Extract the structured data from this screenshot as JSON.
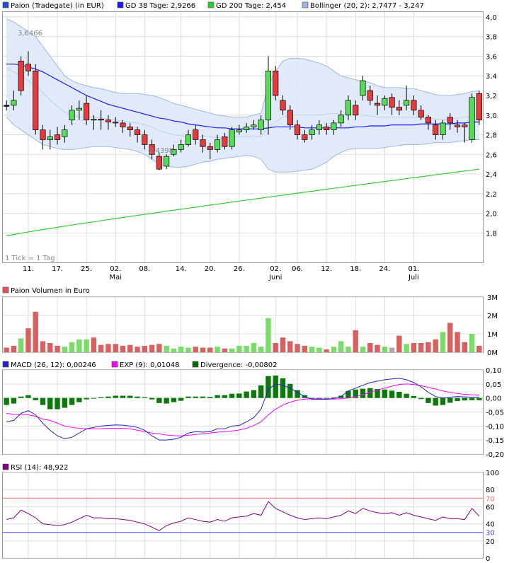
{
  "chart_data": [
    {
      "type": "candlestick",
      "legend": [
        {
          "label": "Paion (Tradegate) (in EUR)",
          "color": "#1f4fd8"
        },
        {
          "label": "GD 38 Tage: 2,9266",
          "color": "#1a1aff"
        },
        {
          "label": "GD 200 Tage: 2,454",
          "color": "#33cc33"
        },
        {
          "label": "Bollinger (20, 2): 2,7477 - 3,247",
          "color": "#9fb8e0"
        }
      ],
      "ylim": [
        1.5,
        4.05
      ],
      "yticks": [
        "1,8",
        "2,0",
        "2,2",
        "2,4",
        "2,6",
        "2,8",
        "3,0",
        "3,2",
        "3,4",
        "3,6",
        "3,8",
        "4,0"
      ],
      "xticks": [
        "11.",
        "17.",
        "25.",
        "02.",
        "08.",
        "14.",
        "20.",
        "26.",
        "02.",
        "06.",
        "12.",
        "18.",
        "24.",
        "01."
      ],
      "month_labels": [
        "Mai",
        "Juni",
        "Juli"
      ],
      "annotations": [
        "3,6466",
        "2,4398"
      ],
      "footnote": "1 Tick = 1 Tag",
      "candles": [
        [
          3.1,
          3.1,
          3.15,
          3.05
        ],
        [
          3.1,
          3.15,
          3.25,
          3.05
        ],
        [
          3.55,
          3.25,
          3.6,
          3.2
        ],
        [
          3.52,
          3.45,
          3.65,
          3.4
        ],
        [
          3.45,
          2.85,
          3.52,
          2.8
        ],
        [
          2.85,
          2.75,
          2.9,
          2.65
        ],
        [
          2.75,
          2.78,
          2.85,
          2.65
        ],
        [
          2.8,
          2.75,
          2.88,
          2.7
        ],
        [
          2.78,
          2.85,
          2.9,
          2.72
        ],
        [
          2.95,
          3.05,
          3.1,
          2.9
        ],
        [
          3.05,
          3.07,
          3.15,
          2.95
        ],
        [
          3.12,
          2.95,
          3.2,
          2.9
        ],
        [
          2.95,
          2.96,
          3.0,
          2.85
        ],
        [
          2.96,
          2.95,
          3.05,
          2.85
        ],
        [
          2.95,
          2.93,
          3.0,
          2.85
        ],
        [
          2.93,
          2.92,
          2.98,
          2.88
        ],
        [
          2.92,
          2.88,
          2.95,
          2.82
        ],
        [
          2.88,
          2.85,
          2.92,
          2.78
        ],
        [
          2.85,
          2.8,
          2.88,
          2.72
        ],
        [
          2.8,
          2.7,
          2.85,
          2.65
        ],
        [
          2.7,
          2.6,
          2.75,
          2.55
        ],
        [
          2.58,
          2.45,
          2.62,
          2.44
        ],
        [
          2.48,
          2.58,
          2.6,
          2.45
        ],
        [
          2.6,
          2.65,
          2.7,
          2.58
        ],
        [
          2.65,
          2.7,
          2.75,
          2.62
        ],
        [
          2.7,
          2.8,
          2.85,
          2.68
        ],
        [
          2.85,
          2.75,
          2.9,
          2.7
        ],
        [
          2.75,
          2.68,
          2.8,
          2.62
        ],
        [
          2.68,
          2.65,
          2.72,
          2.55
        ],
        [
          2.65,
          2.75,
          2.8,
          2.62
        ],
        [
          2.78,
          2.68,
          2.82,
          2.65
        ],
        [
          2.68,
          2.85,
          2.88,
          2.65
        ],
        [
          2.83,
          2.85,
          2.9,
          2.8
        ],
        [
          2.85,
          2.88,
          2.92,
          2.82
        ],
        [
          2.88,
          2.9,
          2.95,
          2.85
        ],
        [
          2.85,
          2.95,
          3.0,
          2.8
        ],
        [
          2.95,
          3.45,
          3.6,
          2.8
        ],
        [
          3.45,
          3.2,
          3.5,
          3.15
        ],
        [
          3.15,
          3.05,
          3.2,
          3.0
        ],
        [
          3.05,
          2.9,
          3.1,
          2.85
        ],
        [
          2.9,
          2.8,
          2.95,
          2.75
        ],
        [
          2.8,
          2.75,
          2.85,
          2.72
        ],
        [
          2.8,
          2.85,
          2.9,
          2.75
        ],
        [
          2.85,
          2.9,
          2.95,
          2.8
        ],
        [
          2.88,
          2.85,
          2.92,
          2.8
        ],
        [
          2.85,
          2.92,
          2.95,
          2.8
        ],
        [
          2.92,
          3.0,
          3.05,
          2.88
        ],
        [
          3.0,
          3.15,
          3.2,
          2.95
        ],
        [
          3.1,
          3.0,
          3.15,
          2.95
        ],
        [
          3.2,
          3.35,
          3.4,
          3.15
        ],
        [
          3.25,
          3.15,
          3.3,
          3.1
        ],
        [
          3.12,
          3.1,
          3.2,
          3.0
        ],
        [
          3.1,
          3.17,
          3.2,
          3.05
        ],
        [
          3.18,
          3.08,
          3.22,
          3.0
        ],
        [
          3.08,
          3.05,
          3.15,
          3.0
        ],
        [
          3.1,
          3.15,
          3.3,
          3.05
        ],
        [
          3.15,
          3.05,
          3.2,
          3.0
        ],
        [
          3.05,
          2.98,
          3.1,
          2.95
        ],
        [
          2.98,
          2.92,
          3.0,
          2.85
        ],
        [
          2.9,
          2.8,
          2.95,
          2.75
        ],
        [
          2.8,
          2.92,
          2.95,
          2.75
        ],
        [
          2.98,
          2.92,
          3.02,
          2.85
        ],
        [
          2.9,
          2.88,
          2.95,
          2.82
        ],
        [
          2.9,
          2.88,
          2.92,
          2.72
        ],
        [
          2.75,
          3.18,
          3.22,
          2.72
        ],
        [
          3.22,
          2.95,
          3.25,
          2.9
        ]
      ],
      "gd38": [
        3.52,
        3.52,
        3.51,
        3.49,
        3.47,
        3.44,
        3.4,
        3.36,
        3.32,
        3.28,
        3.24,
        3.2,
        3.17,
        3.14,
        3.11,
        3.09,
        3.07,
        3.05,
        3.03,
        3.01,
        2.99,
        2.97,
        2.96,
        2.94,
        2.93,
        2.91,
        2.9,
        2.89,
        2.88,
        2.87,
        2.87,
        2.86,
        2.86,
        2.86,
        2.86,
        2.86,
        2.87,
        2.88,
        2.88,
        2.88,
        2.88,
        2.87,
        2.87,
        2.87,
        2.87,
        2.87,
        2.87,
        2.87,
        2.88,
        2.88,
        2.89,
        2.89,
        2.89,
        2.9,
        2.9,
        2.9,
        2.9,
        2.91,
        2.91,
        2.91,
        2.91,
        2.91,
        2.92,
        2.92,
        2.93,
        2.93
      ],
      "gd200": {
        "start": 1.77,
        "end": 2.45
      },
      "boll_upper": [
        3.98,
        3.95,
        3.9,
        3.85,
        3.8,
        3.7,
        3.6,
        3.5,
        3.4,
        3.35,
        3.32,
        3.3,
        3.28,
        3.27,
        3.25,
        3.23,
        3.22,
        3.22,
        3.22,
        3.21,
        3.2,
        3.18,
        3.15,
        3.12,
        3.1,
        3.08,
        3.06,
        3.04,
        3.02,
        3.0,
        2.99,
        2.98,
        2.98,
        2.98,
        3.0,
        3.02,
        3.3,
        3.45,
        3.55,
        3.58,
        3.58,
        3.57,
        3.55,
        3.53,
        3.5,
        3.45,
        3.4,
        3.38,
        3.36,
        3.35,
        3.33,
        3.3,
        3.28,
        3.28,
        3.28,
        3.27,
        3.27,
        3.25,
        3.23,
        3.21,
        3.2,
        3.2,
        3.21,
        3.22,
        3.24,
        3.25
      ],
      "boll_lower": [
        2.98,
        2.9,
        2.85,
        2.8,
        2.75,
        2.7,
        2.68,
        2.66,
        2.65,
        2.65,
        2.66,
        2.67,
        2.68,
        2.68,
        2.68,
        2.67,
        2.66,
        2.65,
        2.63,
        2.6,
        2.55,
        2.5,
        2.48,
        2.47,
        2.47,
        2.48,
        2.5,
        2.52,
        2.53,
        2.55,
        2.56,
        2.57,
        2.58,
        2.59,
        2.58,
        2.55,
        2.45,
        2.42,
        2.42,
        2.42,
        2.43,
        2.44,
        2.45,
        2.48,
        2.52,
        2.58,
        2.62,
        2.65,
        2.66,
        2.66,
        2.66,
        2.66,
        2.67,
        2.68,
        2.69,
        2.7,
        2.7,
        2.7,
        2.71,
        2.72,
        2.72,
        2.72,
        2.73,
        2.74,
        2.75,
        2.75
      ],
      "boll_mid": [
        3.48,
        3.44,
        3.4,
        3.35,
        3.3,
        3.23,
        3.15,
        3.09,
        3.03,
        3.0,
        2.98,
        2.98,
        2.98,
        2.97,
        2.96,
        2.95,
        2.94,
        2.93,
        2.92,
        2.9,
        2.88,
        2.84,
        2.82,
        2.8,
        2.79,
        2.78,
        2.78,
        2.78,
        2.78,
        2.77,
        2.77,
        2.78,
        2.78,
        2.78,
        2.79,
        2.78,
        2.88,
        2.93,
        2.98,
        3.0,
        3.0,
        3.0,
        3.0,
        3.0,
        3.01,
        3.02,
        3.01,
        3.01,
        3.01,
        3.0,
        2.99,
        2.98,
        2.98,
        2.98,
        2.98,
        2.98,
        2.98,
        2.97,
        2.97,
        2.96,
        2.96,
        2.96,
        2.97,
        2.98,
        2.99,
        3.0
      ]
    },
    {
      "type": "bar",
      "title": "Paion Volumen in Euro",
      "yticks": [
        "0M",
        "1M",
        "2M",
        "3M"
      ],
      "ylim": [
        0,
        3.0
      ],
      "values": [
        0.25,
        0.35,
        0.75,
        1.3,
        2.2,
        0.6,
        0.5,
        0.35,
        0.3,
        0.55,
        0.7,
        0.7,
        0.8,
        0.4,
        0.45,
        0.45,
        0.35,
        0.4,
        0.3,
        0.35,
        0.4,
        0.45,
        0.35,
        0.2,
        0.3,
        0.25,
        0.3,
        0.25,
        0.25,
        0.3,
        0.2,
        0.2,
        0.35,
        0.35,
        0.5,
        0.3,
        1.85,
        0.5,
        0.8,
        0.6,
        0.45,
        0.35,
        0.3,
        0.25,
        0.15,
        0.3,
        0.6,
        0.3,
        1.2,
        0.3,
        0.5,
        0.4,
        0.3,
        0.25,
        0.9,
        0.45,
        0.5,
        0.5,
        0.55,
        0.7,
        1.1,
        1.6,
        1.1,
        0.55,
        1.0,
        0.35
      ],
      "directions": [
        "d",
        "d",
        "u",
        "d",
        "d",
        "d",
        "d",
        "d",
        "u",
        "u",
        "u",
        "u",
        "d",
        "d",
        "d",
        "d",
        "d",
        "d",
        "d",
        "d",
        "d",
        "d",
        "u",
        "u",
        "u",
        "u",
        "d",
        "d",
        "d",
        "u",
        "d",
        "u",
        "u",
        "u",
        "u",
        "u",
        "u",
        "d",
        "d",
        "d",
        "d",
        "d",
        "u",
        "u",
        "d",
        "u",
        "u",
        "u",
        "d",
        "u",
        "d",
        "d",
        "u",
        "n",
        "d",
        "u",
        "d",
        "d",
        "d",
        "d",
        "u",
        "d",
        "d",
        "d",
        "u",
        "d"
      ]
    },
    {
      "type": "line",
      "legend": [
        {
          "label": "MACD (26, 12): 0,00246",
          "color": "#2222cc"
        },
        {
          "label": "EXP (9): 0,01048",
          "color": "#ff00ff"
        },
        {
          "label": "Divergence: -0,00802",
          "color": "#0a6b0a"
        }
      ],
      "ylim": [
        -0.2,
        0.1
      ],
      "yticks": [
        "0,10",
        "0,05",
        "0,00",
        "-0,05",
        "-0,10",
        "-0,15",
        "-0,20"
      ],
      "macd": [
        -0.085,
        -0.08,
        -0.055,
        -0.045,
        -0.06,
        -0.09,
        -0.115,
        -0.135,
        -0.145,
        -0.14,
        -0.125,
        -0.11,
        -0.105,
        -0.1,
        -0.098,
        -0.096,
        -0.097,
        -0.1,
        -0.105,
        -0.115,
        -0.135,
        -0.15,
        -0.15,
        -0.147,
        -0.14,
        -0.125,
        -0.12,
        -0.122,
        -0.12,
        -0.11,
        -0.11,
        -0.1,
        -0.098,
        -0.085,
        -0.07,
        -0.04,
        0.03,
        0.05,
        0.045,
        0.035,
        0.02,
        0.005,
        -0.005,
        -0.005,
        -0.005,
        -0.002,
        0.005,
        0.025,
        0.035,
        0.045,
        0.055,
        0.06,
        0.065,
        0.068,
        0.07,
        0.065,
        0.055,
        0.04,
        0.02,
        0.005,
        0.0,
        0.003,
        0.005,
        0.004,
        0.003,
        0.0025
      ],
      "signal": [
        -0.055,
        -0.058,
        -0.058,
        -0.06,
        -0.065,
        -0.075,
        -0.08,
        -0.09,
        -0.1,
        -0.105,
        -0.108,
        -0.11,
        -0.11,
        -0.11,
        -0.108,
        -0.108,
        -0.108,
        -0.11,
        -0.115,
        -0.12,
        -0.125,
        -0.128,
        -0.132,
        -0.134,
        -0.135,
        -0.133,
        -0.13,
        -0.128,
        -0.125,
        -0.122,
        -0.12,
        -0.118,
        -0.114,
        -0.108,
        -0.098,
        -0.085,
        -0.06,
        -0.04,
        -0.025,
        -0.015,
        -0.008,
        -0.004,
        -0.003,
        -0.003,
        -0.004,
        -0.004,
        -0.003,
        0.0,
        0.005,
        0.012,
        0.02,
        0.028,
        0.035,
        0.042,
        0.048,
        0.05,
        0.048,
        0.044,
        0.038,
        0.032,
        0.025,
        0.02,
        0.016,
        0.013,
        0.011,
        0.0105
      ],
      "divergence": [
        -0.025,
        -0.02,
        0.005,
        0.01,
        -0.008,
        -0.025,
        -0.04,
        -0.04,
        -0.035,
        -0.025,
        -0.015,
        -0.005,
        0.0,
        0.003,
        0.005,
        0.008,
        0.008,
        0.008,
        0.005,
        0.003,
        -0.005,
        -0.018,
        -0.02,
        -0.015,
        -0.01,
        0.005,
        0.005,
        0.005,
        0.004,
        0.01,
        0.01,
        0.015,
        0.016,
        0.023,
        0.028,
        0.045,
        0.078,
        0.08,
        0.07,
        0.05,
        0.028,
        0.01,
        -0.002,
        -0.002,
        -0.001,
        0.002,
        0.008,
        0.025,
        0.03,
        0.033,
        0.035,
        0.032,
        0.03,
        0.026,
        0.022,
        0.015,
        0.007,
        -0.004,
        -0.018,
        -0.027,
        -0.025,
        -0.017,
        -0.011,
        -0.009,
        -0.008,
        -0.008
      ]
    },
    {
      "type": "line",
      "legend": [
        {
          "label": "RSI (14): 48,922",
          "color": "#800080"
        }
      ],
      "ylim": [
        0,
        100
      ],
      "yticks": [
        "100",
        "80",
        "70",
        "60",
        "40",
        "30",
        "20",
        "0"
      ],
      "levels": [
        {
          "value": 70,
          "label": "70",
          "color": "#ff6666"
        },
        {
          "value": 30,
          "label": "30",
          "color": "#4444ff"
        }
      ],
      "values": [
        45,
        47,
        56,
        52,
        47,
        40,
        39,
        38,
        39,
        42,
        46,
        50,
        47,
        47,
        46,
        46,
        45,
        44,
        42,
        40,
        36,
        32,
        38,
        41,
        43,
        47,
        45,
        43,
        42,
        45,
        43,
        47,
        48,
        49,
        52,
        50,
        66,
        58,
        54,
        50,
        47,
        45,
        46,
        47,
        46,
        48,
        50,
        55,
        52,
        58,
        55,
        53,
        52,
        53,
        50,
        53,
        50,
        48,
        46,
        44,
        48,
        46,
        46,
        45,
        58,
        49
      ]
    }
  ]
}
